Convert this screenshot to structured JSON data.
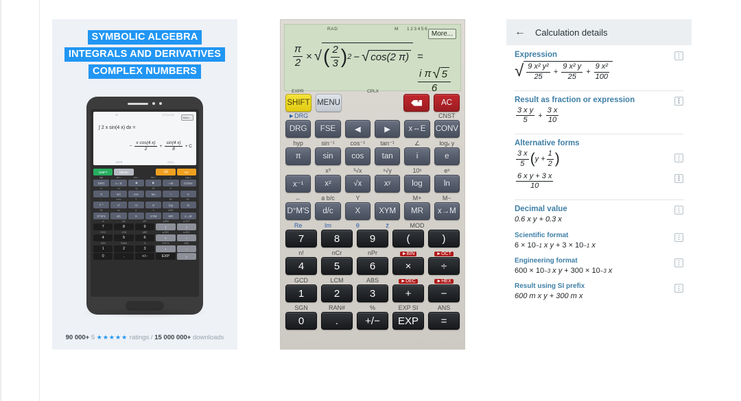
{
  "promo": {
    "title_lines": [
      "SYMBOLIC ALGEBRA",
      "INTEGRALS AND DERIVATIVES",
      "COMPLEX NUMBERS"
    ],
    "phone": {
      "display": {
        "status_top": [
          "M",
          "1 2 3 4 5 6"
        ],
        "more_label": "More...",
        "expression": "∫ 2 x sin(4 x) dx =",
        "result_minus": "−",
        "result_frac1_n": "x cos(4 x)",
        "result_frac1_d": "2",
        "result_plus": "+",
        "result_frac2_n": "sin(4 x)",
        "result_frac2_d": "8",
        "result_const": "+ C",
        "status_bot": [
          "EXPR",
          "CPLX"
        ]
      },
      "keys": {
        "row1": [
          "SHIFT",
          "MENU",
          "",
          "⌫",
          "AC"
        ],
        "row1_labels": [
          "►DRG",
          "",
          "",
          "",
          "CNST"
        ],
        "row2": [
          "DRG",
          "x⇔E",
          "◀",
          "▶",
          "⌐ok",
          "CONV"
        ],
        "row2_labels": [
          "hyp",
          "sin⁻¹",
          "cos⁻¹",
          "tan⁻¹",
          "∠",
          "logₓ y"
        ],
        "row3": [
          "π",
          "sin",
          "cos",
          "tan",
          "i",
          "e"
        ],
        "row3_labels": [
          "x³",
          "³√x",
          "ˣ√y",
          "10ˣ",
          "eˣ"
        ],
        "row4": [
          "x⁻¹",
          "x²",
          "√x",
          "xʸ",
          "log",
          "ln"
        ],
        "row4_labels": [
          "←",
          "a b/c",
          "Y",
          "M+",
          "M−"
        ],
        "row5": [
          "D°M'S",
          "d/c",
          "X",
          "XYM",
          "MR",
          "x→M"
        ],
        "row5_labels": [
          "Re",
          "Im",
          "θ",
          "z̄",
          "MOD"
        ],
        "row6": [
          "7",
          "8",
          "9",
          "(",
          ")"
        ],
        "row6_labels": [
          "n!",
          "nCr",
          "nPr",
          "►BIN",
          "►OCT"
        ],
        "row7": [
          "4",
          "5",
          "6",
          "×",
          "÷"
        ],
        "row7_labels": [
          "GCD",
          "LCM",
          "ABS",
          "►DEC",
          "►HEX"
        ],
        "row8": [
          "1",
          "2",
          "3",
          "+",
          "−"
        ],
        "row8_labels": [
          "SGN",
          "RAN#",
          "%",
          "EXP SI",
          "ANS"
        ],
        "row9": [
          "0",
          ".",
          "+/−",
          "EXP",
          "="
        ]
      }
    },
    "footer": {
      "ratings_count": "90 000+",
      "five": "5",
      "stars": "★★★★★",
      "ratings_word": "ratings /",
      "downloads_count": "15 000 000+",
      "downloads_word": "downloads"
    }
  },
  "calculator": {
    "display": {
      "angle_mode": "RAD",
      "memory": "M",
      "digits": "123456",
      "more_label": "More...",
      "expr_frac_n": "π",
      "expr_frac_d": "2",
      "expr_times": "×",
      "expr_inner_frac_n": "2",
      "expr_inner_frac_d": "3",
      "expr_power": "2",
      "expr_minus": "−",
      "expr_cos": "cos(2 π)",
      "expr_equals": "=",
      "result_i": "i π",
      "result_sqrt": "5",
      "result_den": "6",
      "indicator_left": "EXPR",
      "indicator_right": "CPLX"
    },
    "keys": {
      "row1": [
        "SHIFT",
        "MENU"
      ],
      "row1_right": [
        "⌫",
        "AC"
      ],
      "row1_labels": [
        "►DRG",
        "",
        "",
        "",
        "",
        "CNST"
      ],
      "row2": [
        "DRG",
        "FSE",
        "◀",
        "▶",
        "x⇔E",
        "CONV"
      ],
      "row2_labels": [
        "hyp",
        "sin⁻¹",
        "cos⁻¹",
        "tan⁻¹",
        "∠",
        "logₓ y"
      ],
      "row3": [
        "π",
        "sin",
        "cos",
        "tan",
        "i",
        "e"
      ],
      "row3_labels": [
        "",
        "x³",
        "³√x",
        "ˣ√y",
        "10ˣ",
        "eˣ"
      ],
      "row4": [
        "x⁻¹",
        "x²",
        "√x",
        "xʸ",
        "log",
        "ln"
      ],
      "row4_labels": [
        "←",
        "a b/c",
        "Y",
        "",
        "M+",
        "M−"
      ],
      "row5": [
        "D°M'S",
        "d/c",
        "X",
        "XYM",
        "MR",
        "x→M"
      ],
      "row5_labels": [
        "Re",
        "Im",
        "θ",
        "z̄",
        "MOD"
      ],
      "row6": [
        "7",
        "8",
        "9",
        "(",
        ")"
      ],
      "row6_labels": [
        "n!",
        "nCr",
        "nPr",
        "►BIN",
        "►OCT"
      ],
      "row7": [
        "4",
        "5",
        "6",
        "×",
        "÷"
      ],
      "row7_labels": [
        "GCD",
        "LCM",
        "ABS",
        "►DEC",
        "►HEX"
      ],
      "row8": [
        "1",
        "2",
        "3",
        "+",
        "−"
      ],
      "row8_labels": [
        "SGN",
        "RAN#",
        "%",
        "EXP SI",
        "ANS"
      ],
      "row9": [
        "0",
        ".",
        "+/−",
        "EXP",
        "="
      ]
    }
  },
  "details": {
    "appbar": {
      "back_icon": "arrow-left",
      "title": "Calculation details"
    },
    "sections": {
      "expression": {
        "heading": "Expression",
        "t1_n": "9 x² y²",
        "t1_d": "25",
        "op1": "+",
        "t2_n": "9 x² y",
        "t2_d": "25",
        "op2": "+",
        "t3_n": "9 x²",
        "t3_d": "100"
      },
      "result_fraction": {
        "heading": "Result as fraction or expression",
        "t1_n": "3 x y",
        "t1_d": "5",
        "op": "+",
        "t2_n": "3 x",
        "t2_d": "10"
      },
      "alternative": {
        "heading": "Alternative forms",
        "form1_n": "3 x",
        "form1_d": "5",
        "form1_inner_y": "y +",
        "form1_inner_n": "1",
        "form1_inner_d": "2",
        "form2_n": "6 x y + 3 x",
        "form2_d": "10"
      },
      "decimal": {
        "heading": "Decimal value",
        "value": "0.6 x y + 0.3 x"
      },
      "scientific": {
        "heading": "Scientific format",
        "p1": "6 × 10",
        "e1": "−1",
        "v1": "x y",
        "op": "+",
        "p2": "3 × 10",
        "e2": "−1",
        "v2": "x"
      },
      "engineering": {
        "heading": "Engineering format",
        "p1": "600 × 10",
        "e1": "−3",
        "v1": "x y",
        "op": "+",
        "p2": "300 × 10",
        "e2": "−3",
        "v2": "x"
      },
      "si_prefix": {
        "heading": "Result using SI prefix",
        "value": "600 m x y + 300 m x"
      }
    }
  }
}
